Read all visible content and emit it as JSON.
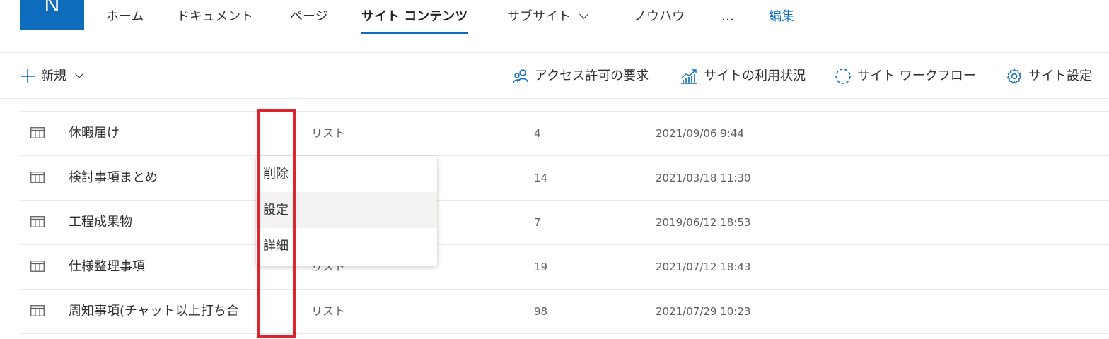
{
  "logo": {
    "letter": "N",
    "color": "#0f6cbd"
  },
  "nav": {
    "items": [
      {
        "label": "ホーム"
      },
      {
        "label": "ドキュメント"
      },
      {
        "label": "ページ"
      },
      {
        "label": "サイト コンテンツ",
        "active": true
      },
      {
        "label": "サブサイト",
        "has_dropdown": true
      },
      {
        "label": "ノウハウ"
      },
      {
        "label": "…"
      },
      {
        "label": "編集",
        "link": true
      }
    ]
  },
  "command_bar": {
    "new_label": "新規",
    "access_request_label": "アクセス許可の要求",
    "site_usage_label": "サイトの利用状況",
    "site_workflow_label": "サイト ワークフロー",
    "site_settings_label": "サイト設定"
  },
  "list": {
    "rows": [
      {
        "name": "休暇届け",
        "type": "リスト",
        "count": "4",
        "modified": "2021/09/06 9:44"
      },
      {
        "name": "検討事項まとめ",
        "type": "",
        "count": "14",
        "modified": "2021/03/18 11:30"
      },
      {
        "name": "工程成果物",
        "type": "",
        "count": "7",
        "modified": "2019/06/12 18:53"
      },
      {
        "name": "仕様整理事項",
        "type": "リスト",
        "count": "19",
        "modified": "2021/07/12 18:43"
      },
      {
        "name": "周知事項(チャット以上打ち合",
        "type": "リスト",
        "count": "98",
        "modified": "2021/07/29 10:23"
      }
    ]
  },
  "context_menu": {
    "items": [
      {
        "label": "削除"
      },
      {
        "label": "設定",
        "hovered": true
      },
      {
        "label": "詳細"
      }
    ]
  },
  "colors": {
    "accent": "#0f6cbd",
    "highlight": "#e0242e",
    "hover_bg": "#f3f2f1",
    "divider": "#edebe9"
  }
}
